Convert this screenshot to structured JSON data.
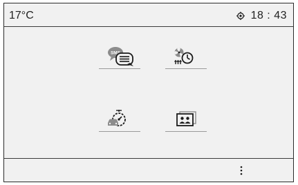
{
  "status_bar": {
    "temperature": "17°C",
    "time": "18 : 43",
    "gps_icon": "gps-fix-icon"
  },
  "apps": [
    {
      "name": "messages",
      "icon": "sms-message-icon",
      "badge": "SMS"
    },
    {
      "name": "climate-programming",
      "icon": "fan-timer-icon"
    },
    {
      "name": "driving-functions",
      "icon": "car-gauge-icon"
    },
    {
      "name": "contacts",
      "icon": "contacts-card-icon"
    }
  ],
  "bottom_bar": {
    "more_icon": "more-options-icon"
  },
  "colors": {
    "background": "#f1f1f1",
    "frame": "#2a2a2a",
    "icon": "#1a1a1a",
    "underline": "#9a9a9a"
  }
}
